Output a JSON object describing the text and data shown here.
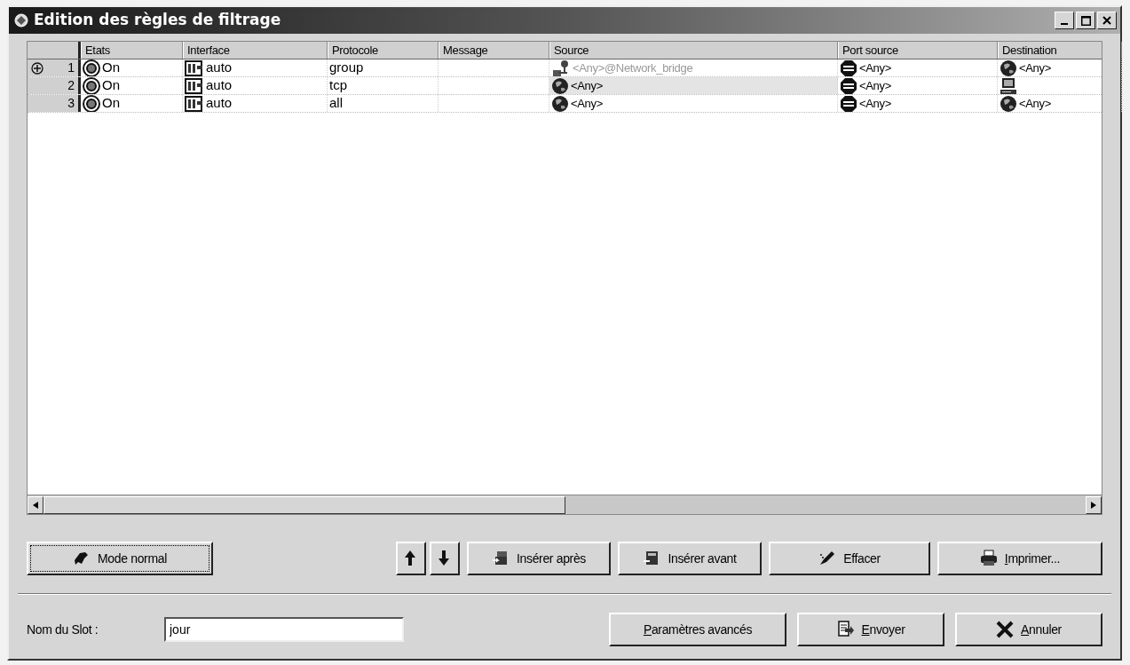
{
  "window": {
    "title": "Edition des règles de filtrage"
  },
  "table": {
    "columns": [
      "Etats",
      "Interface",
      "Protocole",
      "Message",
      "Source",
      "Port source",
      "Destination"
    ],
    "rows": [
      {
        "number": "1",
        "expandable": true,
        "cells": [
          {
            "kind": "radio",
            "text": "On"
          },
          {
            "kind": "interface",
            "text": "auto"
          },
          {
            "kind": "plain",
            "text": "group"
          },
          {
            "kind": "plain"
          },
          {
            "kind": "network",
            "text": "<Any>@Network_bridge",
            "dimmed": true
          },
          {
            "kind": "port",
            "text": "<Any>"
          },
          {
            "kind": "globe",
            "text": "<Any>"
          }
        ]
      },
      {
        "number": "2",
        "expandable": false,
        "cells": [
          {
            "kind": "radio",
            "text": "On"
          },
          {
            "kind": "interface",
            "text": "auto"
          },
          {
            "kind": "plain",
            "text": "tcp"
          },
          {
            "kind": "plain"
          },
          {
            "kind": "globe",
            "text": "<Any>",
            "dimmed": false
          },
          {
            "kind": "port",
            "text": "<Any>"
          },
          {
            "kind": "computer"
          }
        ]
      },
      {
        "number": "3",
        "expandable": false,
        "cells": [
          {
            "kind": "radio",
            "text": "On"
          },
          {
            "kind": "interface",
            "text": "auto"
          },
          {
            "kind": "plain",
            "text": "all"
          },
          {
            "kind": "plain"
          },
          {
            "kind": "globe",
            "text": "<Any>",
            "dimmed": false
          },
          {
            "kind": "port",
            "text": "<Any>"
          },
          {
            "kind": "globe",
            "text": "<Any>"
          }
        ]
      }
    ]
  },
  "toolbar": [
    {
      "kind": "mode",
      "label": "Mode normal",
      "underline_first": false,
      "focused": true
    },
    {
      "kind": "up"
    },
    {
      "kind": "down"
    },
    {
      "kind": "insert_after",
      "label": "Insérer après",
      "underline_first": false,
      "focused": false
    },
    {
      "kind": "insert_before",
      "label": "Insérer avant",
      "underline_first": false,
      "focused": false
    },
    {
      "kind": "erase",
      "label": "Effacer",
      "underline_first": false,
      "focused": false
    },
    {
      "kind": "print",
      "label": "Imprimer...",
      "underline_first": true,
      "focused": false
    }
  ],
  "slot": {
    "label": "Nom du Slot :",
    "value": "jour"
  },
  "actions": [
    {
      "kind": "advanced",
      "label": "Paramètres avancés",
      "underline_first": true
    },
    {
      "kind": "send",
      "label": "Envoyer",
      "underline_first": true
    },
    {
      "kind": "cancel",
      "label": "Annuler",
      "underline_first": true
    }
  ]
}
